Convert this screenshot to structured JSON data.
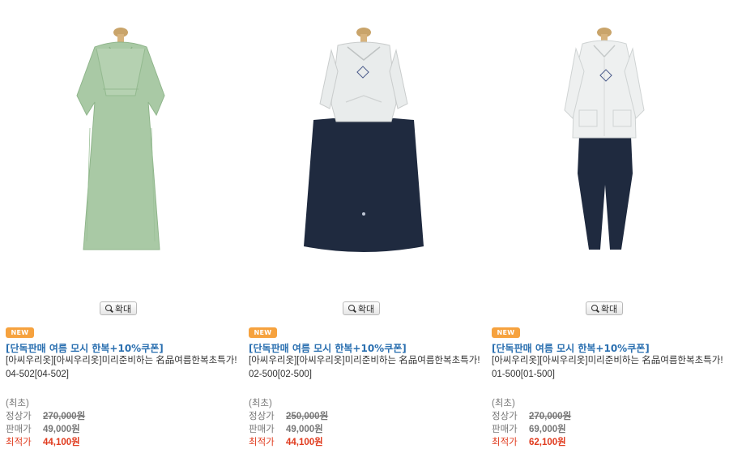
{
  "products": [
    {
      "zoom_label": "확대",
      "badge": "NEW",
      "title": "[단독판매 여름 모시 한복+10%쿠폰]",
      "desc": "[아씨우리옷][아씨우리옷]미리준비하는 名品여름한복초특가! 04-502[04-502]",
      "first_label": "(최초)",
      "regular_label": "정상가",
      "regular_price": "270,000원",
      "sale_label": "판매가",
      "sale_price": "49,000원",
      "best_label": "최적가",
      "best_price": "44,100원"
    },
    {
      "zoom_label": "확대",
      "badge": "NEW",
      "title": "[단독판매 여름 모시 한복+10%쿠폰]",
      "desc": "[아씨우리옷][아씨우리옷]미리준비하는 名品여름한복초특가! 02-500[02-500]",
      "first_label": "(최초)",
      "regular_label": "정상가",
      "regular_price": "250,000원",
      "sale_label": "판매가",
      "sale_price": "49,000원",
      "best_label": "최적가",
      "best_price": "44,100원"
    },
    {
      "zoom_label": "확대",
      "badge": "NEW",
      "title": "[단독판매 여름 모시 한복+10%쿠폰]",
      "desc": "[아씨우리옷][아씨우리옷]미리준비하는 名品여름한복초특가! 01-500[01-500]",
      "first_label": "(최초)",
      "regular_label": "정상가",
      "regular_price": "270,000원",
      "sale_label": "판매가",
      "sale_price": "69,000원",
      "best_label": "최적가",
      "best_price": "62,100원"
    }
  ],
  "colors": {
    "title": "#2a6fb0",
    "best_price": "#e03a1d",
    "badge": "#f6a23e",
    "green_hanbok": "#a9c9a5",
    "navy_skirt": "#1f2a3f",
    "white_jacket": "#eef0f0"
  }
}
